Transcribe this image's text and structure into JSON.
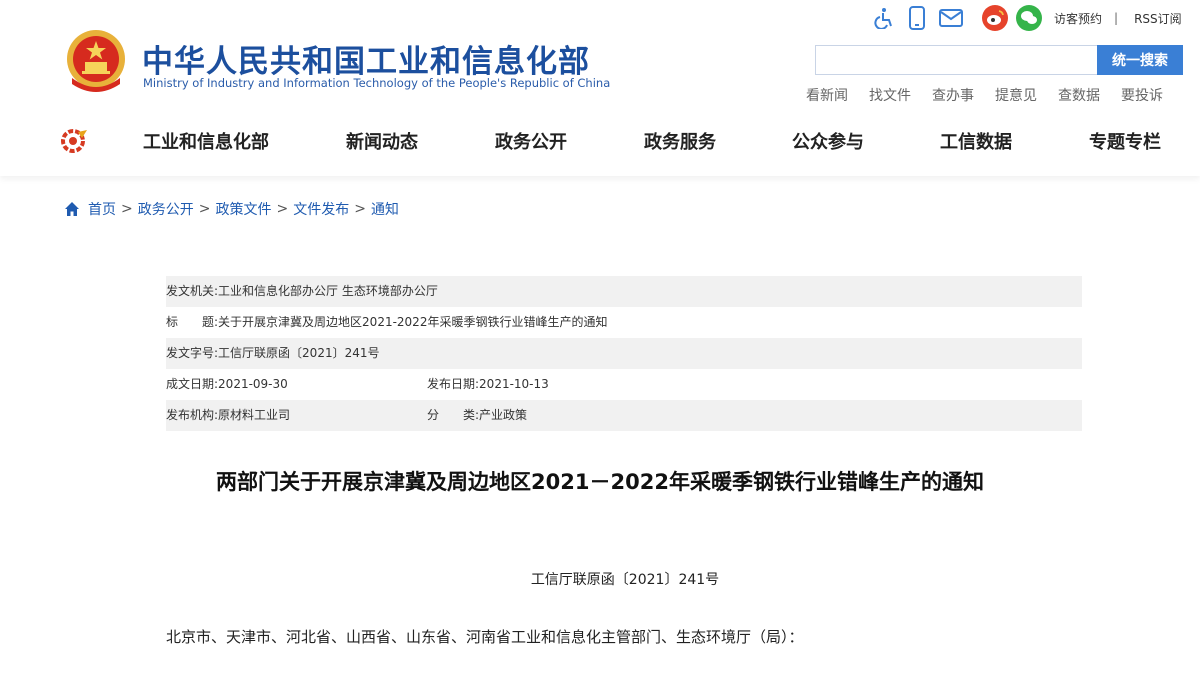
{
  "header": {
    "title_cn": "中华人民共和国工业和信息化部",
    "title_en": "Ministry of Industry and Information Technology of the People's Republic of China",
    "tools": {
      "accessibility_icon": "wheelchair-icon",
      "mobile_icon": "mobile-icon",
      "email_icon": "mail-icon",
      "weibo_icon": "weibo-icon",
      "wechat_icon": "wechat-icon",
      "visitor": "访客预约",
      "separator": "|",
      "rss": "RSS订阅"
    },
    "search": {
      "placeholder": "",
      "button": "统一搜索"
    },
    "quick_links": [
      "看新闻",
      "找文件",
      "查办事",
      "提意见",
      "查数据",
      "要投诉"
    ]
  },
  "nav": {
    "items": [
      "工业和信息化部",
      "新闻动态",
      "政务公开",
      "政务服务",
      "公众参与",
      "工信数据",
      "专题专栏"
    ]
  },
  "breadcrumb": {
    "items": [
      "首页",
      "政务公开",
      "政策文件",
      "文件发布",
      "通知"
    ],
    "sep": ">"
  },
  "doc_info": {
    "issuer_label": "发文机关:",
    "issuer": "工业和信息化部办公厅 生态环境部办公厅",
    "title_label": "标　　题:",
    "title": "关于开展京津冀及周边地区2021-2022年采暖季钢铁行业错峰生产的通知",
    "docno_label": "发文字号:",
    "docno": "工信厅联原函〔2021〕241号",
    "created_label": "成文日期:",
    "created": "2021-09-30",
    "published_label": "发布日期:",
    "published": "2021-10-13",
    "org_label": "发布机构:",
    "org": "原材料工业司",
    "category_label": "分　　类:",
    "category": "产业政策"
  },
  "article": {
    "title": "两部门关于开展京津冀及周边地区2021－2022年采暖季钢铁行业错峰生产的通知",
    "docno": "工信厅联原函〔2021〕241号",
    "recipients": "北京市、天津市、河北省、山西省、山东省、河南省工业和信息化主管部门、生态环境厅（局）："
  },
  "colors": {
    "brand": "#1c4f9e",
    "button": "#3a7fd5",
    "link": "#1f5bb0"
  }
}
